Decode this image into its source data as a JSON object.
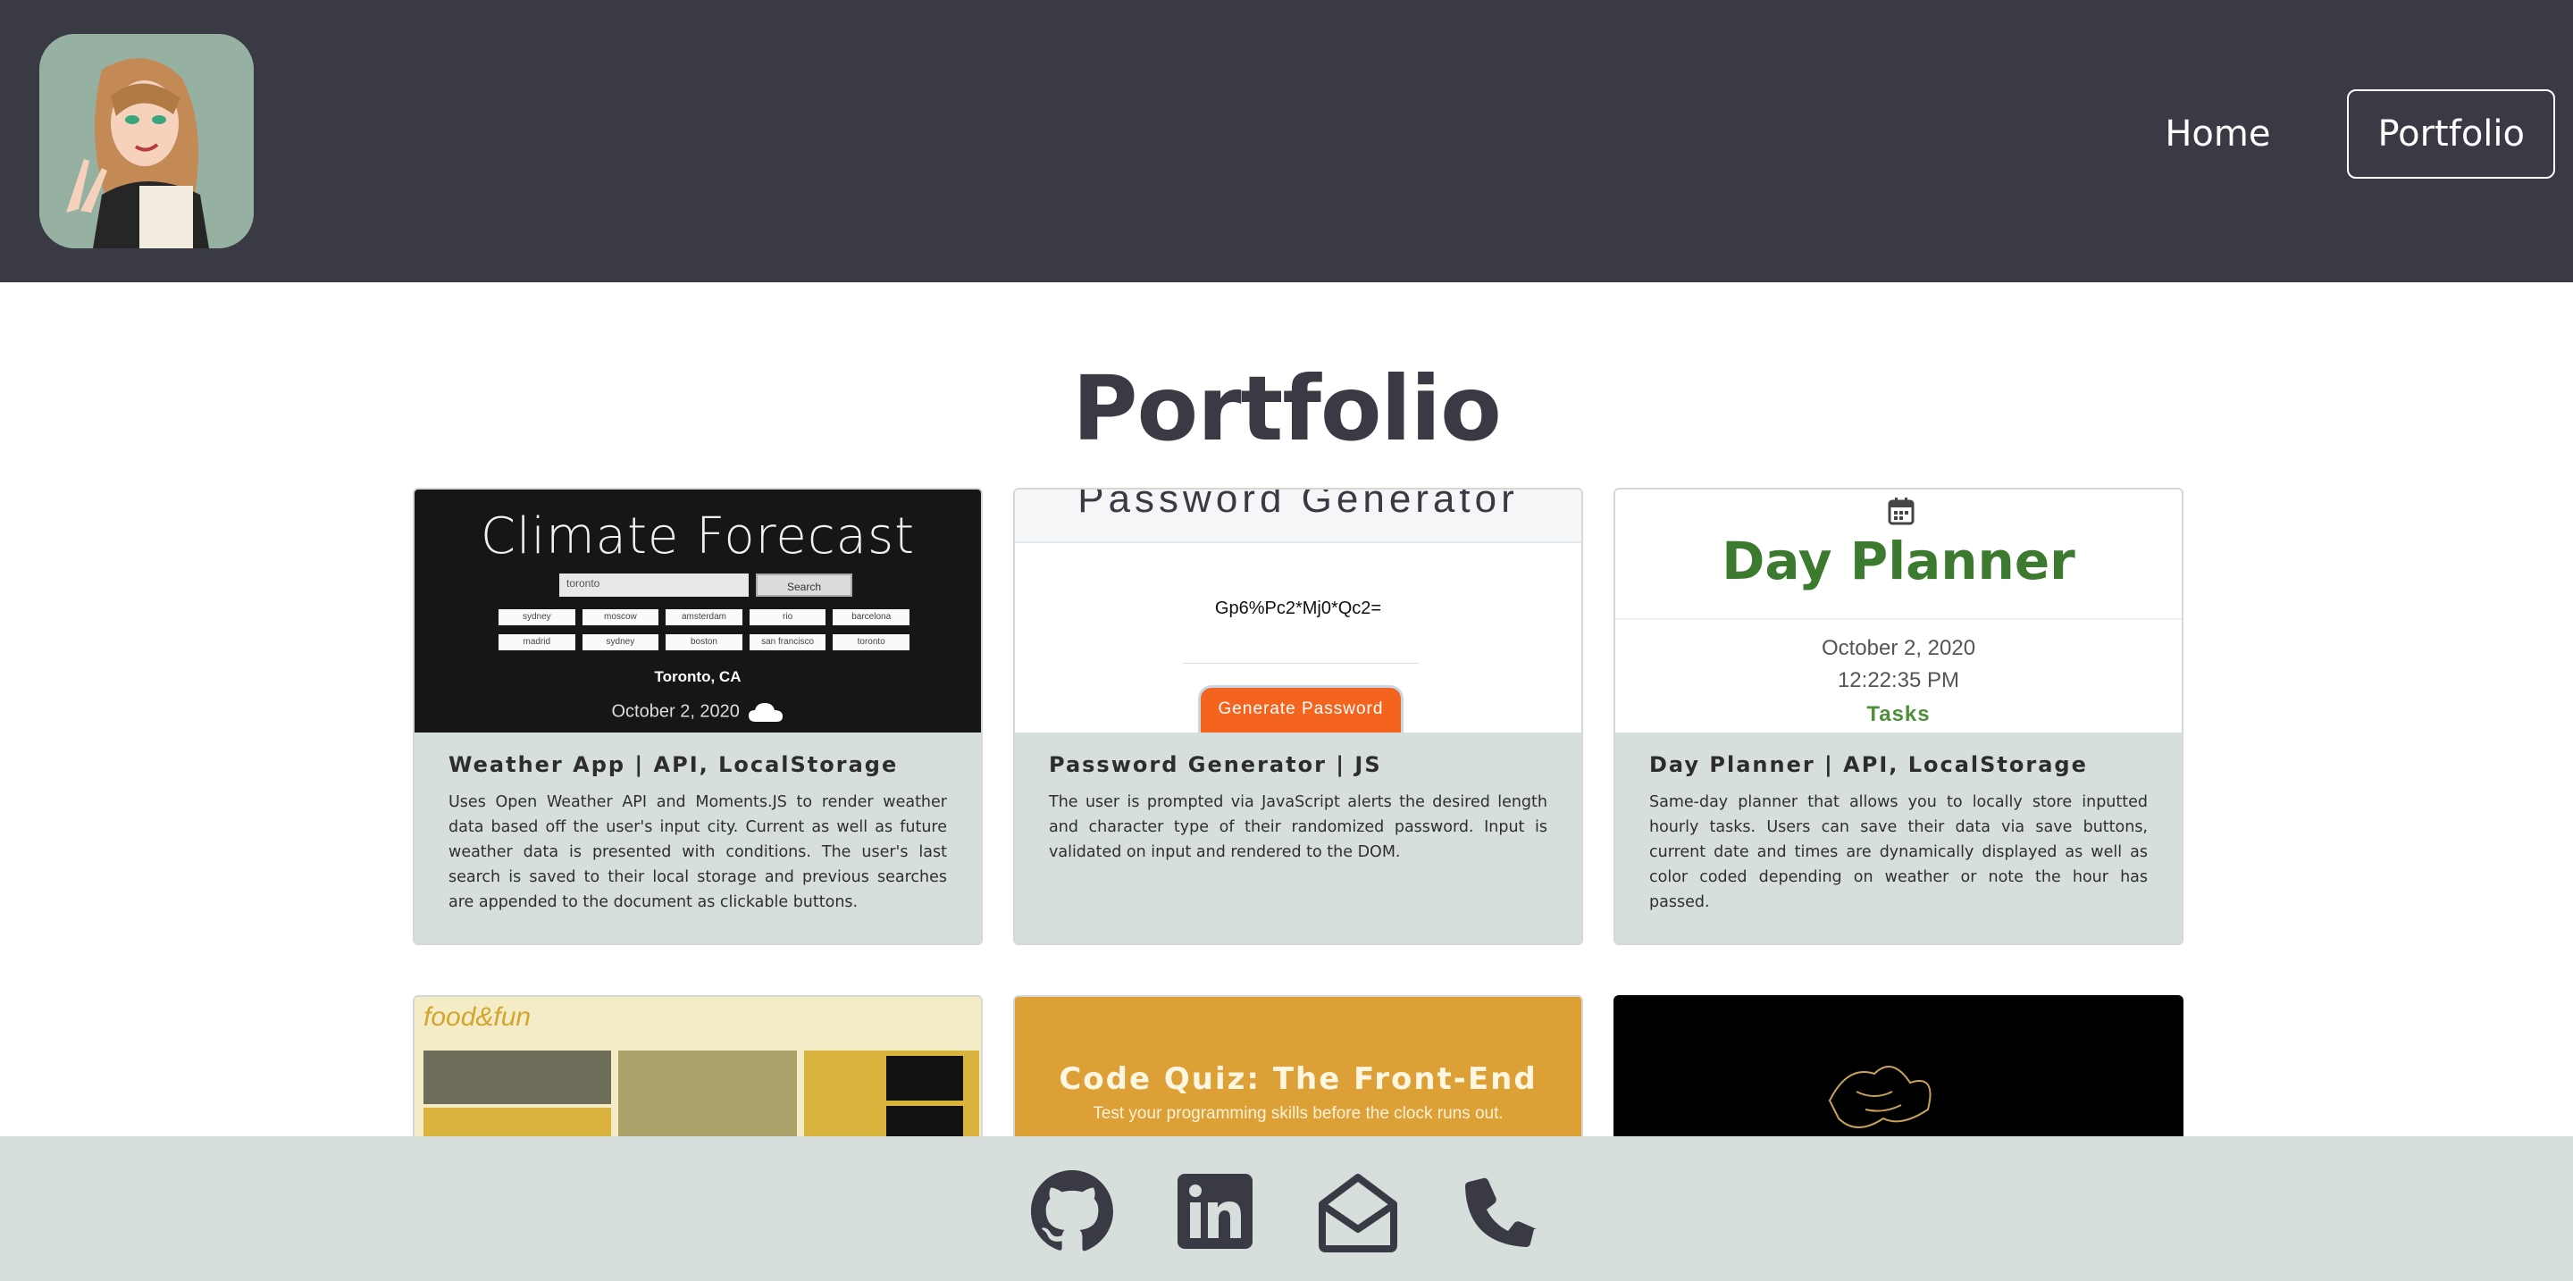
{
  "header": {
    "nav": [
      {
        "label": "Home",
        "active": false
      },
      {
        "label": "Portfolio",
        "active": true
      }
    ]
  },
  "main": {
    "title": "Portfolio",
    "projects": [
      {
        "title": "Weather App | API, LocalStorage",
        "description": "Uses Open Weather API and Moments.JS to render weather data based off the user's input city. Current as well as future weather data is presented with conditions. The user's last search is saved to their local storage and previous searches are appended to the document as clickable buttons.",
        "thumbnail": {
          "heading": "Climate Forecast",
          "search_value": "toronto",
          "search_button": "Search",
          "chips": [
            "sydney",
            "moscow",
            "amsterdam",
            "rio",
            "barcelona",
            "madrid",
            "sydney",
            "boston",
            "san francisco",
            "toronto"
          ],
          "city": "Toronto, CA",
          "date": "October 2, 2020"
        }
      },
      {
        "title": "Password Generator | JS",
        "description": "The user is prompted via JavaScript alerts the desired length and character type of their randomized password. Input is validated on input and rendered to the DOM.",
        "thumbnail": {
          "heading": "Password Generator",
          "password": "Gp6%Pc2*Mj0*Qc2=",
          "button": "Generate Password"
        }
      },
      {
        "title": "Day Planner | API, LocalStorage",
        "description": "Same-day planner that allows you to locally store inputted hourly tasks. Users can save their data via save buttons, current date and times are dynamically displayed as well as color coded depending on weather or note the hour has passed.",
        "thumbnail": {
          "heading": "Day Planner",
          "date": "October 2, 2020",
          "time": "12:22:35 PM",
          "tasks": "Tasks"
        }
      }
    ],
    "row2": [
      {
        "brand": "food&fun"
      },
      {
        "heading": "Code Quiz: The Front-End",
        "subtitle": "Test your programming skills before the clock runs out."
      },
      {}
    ]
  },
  "footer": {
    "icons": [
      "github-icon",
      "linkedin-icon",
      "envelope-open-icon",
      "phone-icon"
    ]
  },
  "colors": {
    "header_bg": "#3a3a44",
    "card_bg": "#d6dfdb",
    "footer_bg": "#d6dfdb",
    "planner_green": "#3c7a2f",
    "quiz_orange": "#dca036",
    "password_button": "#f5641f"
  }
}
